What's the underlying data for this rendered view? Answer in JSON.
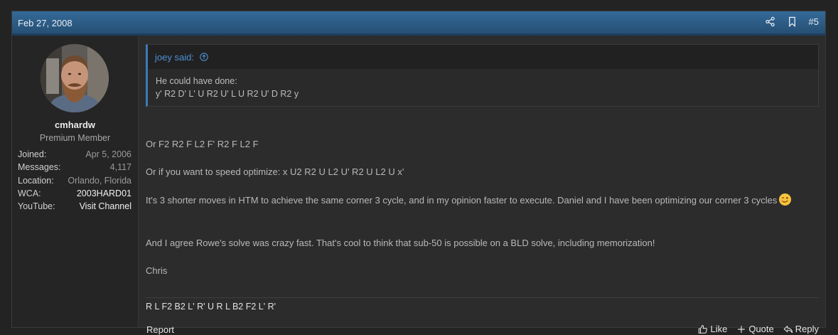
{
  "post": {
    "date": "Feb 27, 2008",
    "number": "#5",
    "header_icons": [
      "share-icon",
      "bookmark-icon"
    ]
  },
  "user": {
    "username": "cmhardw",
    "title": "Premium Member",
    "stats": [
      {
        "key": "Joined:",
        "value": "Apr 5, 2006"
      },
      {
        "key": "Messages:",
        "value": "4,117"
      },
      {
        "key": "Location:",
        "value": "Orlando, Florida"
      },
      {
        "key": "WCA:",
        "value": "2003HARD01"
      },
      {
        "key": "YouTube:",
        "value": "Visit Channel"
      }
    ]
  },
  "quote": {
    "author": "joey said:",
    "lines": [
      "He could have done:",
      "y' R2 D' L' U R2 U' L U R2 U' D R2 y"
    ]
  },
  "body": {
    "paragraphs": [
      "Or F2 R2 F L2 F' R2 F L2 F",
      "Or if you want to speed optimize: x U2 R2 U L2 U' R2 U L2 U x'",
      "It's 3 shorter moves in HTM to achieve the same corner 3 cycle, and in my opinion faster to execute. Daniel and I have been optimizing our corner 3 cycles",
      "And I agree Rowe's solve was crazy fast. That's cool to think that sub-50 is possible on a BLD solve, including memorization!",
      "Chris"
    ]
  },
  "signature": "R L F2 B2 L' R' U R L B2 F2 L' R'",
  "actions": {
    "report": "Report",
    "like": "Like",
    "quote": "Quote",
    "reply": "Reply"
  },
  "colors": {
    "header": "#2f6391",
    "link": "#4d8fd1",
    "background": "#2c2c2d"
  }
}
